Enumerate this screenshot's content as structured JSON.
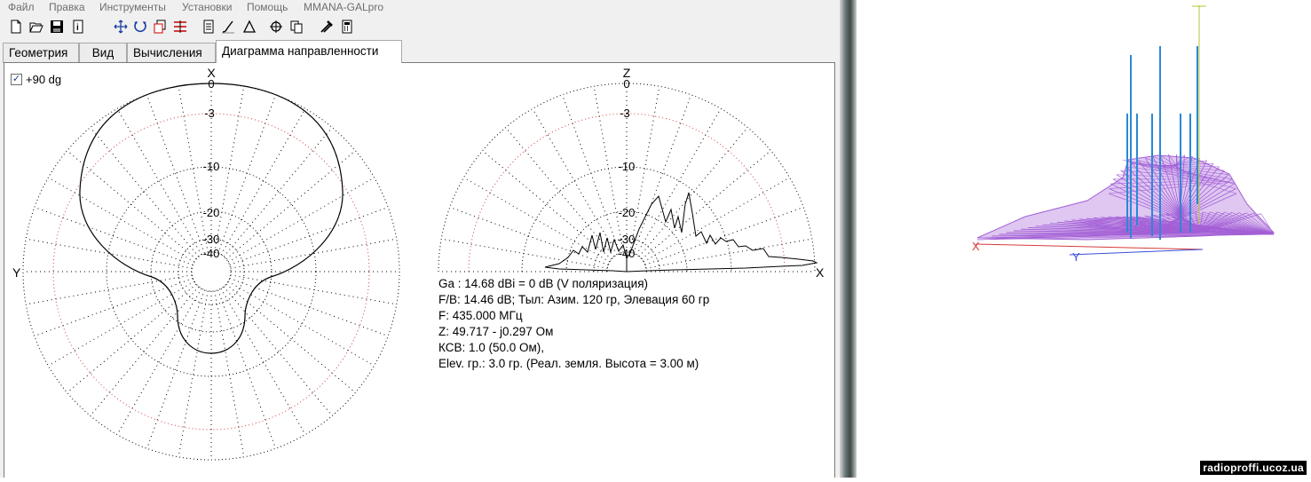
{
  "menu": [
    "Файл",
    "Правка",
    "Инструменты",
    "Установки",
    "Помощь",
    "MMANA-GALpro"
  ],
  "toolbar_icons": [
    "new-file-icon",
    "open-folder-icon",
    "save-disk-icon",
    "info-icon",
    "move-arrows-icon",
    "rotate-icon",
    "copy-icon",
    "wire-edit-icon",
    "document-icon",
    "brush-icon",
    "triangle-icon",
    "crosshair-icon",
    "copy-pages-icon",
    "tools-icon",
    "calculator-icon"
  ],
  "tabs": [
    {
      "label": "Геометрия"
    },
    {
      "label": "Вид"
    },
    {
      "label": "Вычисления"
    },
    {
      "label": "Диаграмма направленности"
    }
  ],
  "checkbox": {
    "label": "+90 dg",
    "checked": true
  },
  "horizontal_plot": {
    "top_axis": "X",
    "side_axis": "Y",
    "ring_labels": [
      "0",
      "-3",
      "-10",
      "-20",
      "-30",
      "-40"
    ]
  },
  "vertical_plot": {
    "top_axis": "Z",
    "side_axis": "X",
    "ring_labels": [
      "0",
      "-3",
      "-10",
      "-20",
      "-30",
      "-40"
    ]
  },
  "info_lines": [
    "Ga : 14.68 dBi = 0 dB  (V поляризация)",
    "F/B: 14.46 dB; Тыл: Азим. 120 гр, Элевация 60 гр",
    "F: 435.000 МГц",
    "Z: 49.717 - j0.297 Ом",
    "КСВ: 1.0 (50.0 Ом),",
    "Elev. гр.: 3.0 гр. (Реал. земля. Высота = 3.00 м)"
  ],
  "view3d": {
    "x_label": "X",
    "y_label": "Y"
  },
  "watermark": "radioproffi.ucoz.ua",
  "colors": {
    "pattern_mesh": "#a35fd6",
    "wire": "#2a88d6",
    "axis_z": "#b3c437",
    "axis_x": "#d83a3a",
    "axis_y": "#3a4fd8"
  }
}
